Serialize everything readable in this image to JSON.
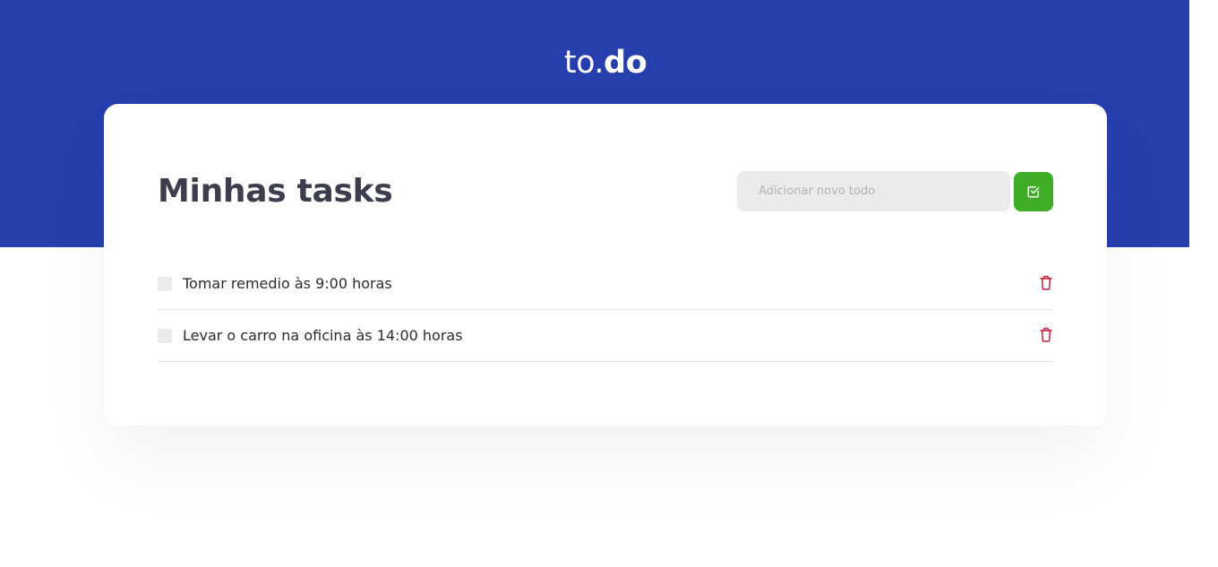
{
  "header": {
    "logo_light": "to.",
    "logo_bold": "do",
    "background_color": "#273fad"
  },
  "main": {
    "title": "Minhas tasks",
    "new_todo": {
      "placeholder": "Adicionar novo todo",
      "value": ""
    },
    "add_button": {
      "icon": "check-square-icon",
      "color": "#3fad27"
    }
  },
  "tasks": [
    {
      "title": "Tomar remedio às 9:00 horas",
      "completed": false
    },
    {
      "title": "Levar o carro na oficina às 14:00 horas",
      "completed": false
    }
  ],
  "icons": {
    "delete": "trash-icon",
    "delete_color": "#c30f32"
  }
}
